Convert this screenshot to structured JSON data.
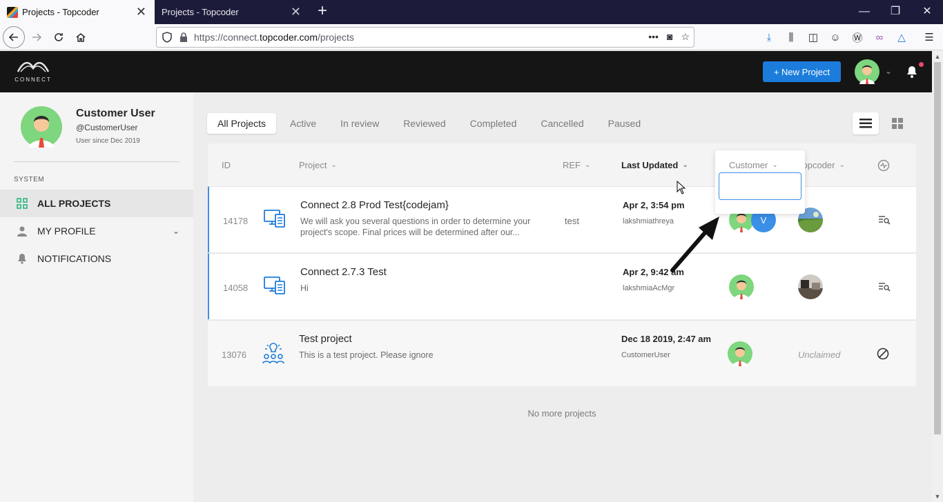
{
  "browser": {
    "tabs": [
      {
        "title": "Projects - Topcoder"
      },
      {
        "title": "Projects - Topcoder"
      }
    ],
    "url_prefix": "https://connect.",
    "url_domain": "topcoder.com",
    "url_path": "/projects"
  },
  "header": {
    "logo_text": "CONNECT",
    "new_project_label": "+ New Project"
  },
  "sidebar": {
    "name": "Customer User",
    "handle": "@CustomerUser",
    "since": "User since Dec 2019",
    "section_label": "SYSTEM",
    "items": [
      {
        "label": "ALL PROJECTS"
      },
      {
        "label": "MY PROFILE"
      },
      {
        "label": "NOTIFICATIONS"
      }
    ]
  },
  "filters": {
    "tabs": [
      "All Projects",
      "Active",
      "In review",
      "Reviewed",
      "Completed",
      "Cancelled",
      "Paused"
    ]
  },
  "table": {
    "headers": {
      "id": "ID",
      "project": "Project",
      "ref": "REF",
      "last_updated": "Last Updated",
      "customer": "Customer",
      "topcoder": "Topcoder"
    },
    "rows": [
      {
        "id": "14178",
        "title": "Connect 2.8 Prod Test{codejam}",
        "desc": "We will ask you several questions in order to determine your project's scope. Final prices will be determined after our...",
        "ref": "test",
        "date": "Apr 2, 3:54 pm",
        "user": "lakshmiathreya",
        "extra_customer": "V",
        "topcoder": ""
      },
      {
        "id": "14058",
        "title": "Connect 2.7.3 Test",
        "desc": "Hi",
        "ref": "",
        "date": "Apr 2, 9:42 am",
        "user": "lakshmiaAcMgr",
        "topcoder": ""
      },
      {
        "id": "13076",
        "title": "Test project",
        "desc": "This is a test project. Please ignore",
        "ref": "",
        "date": "Dec 18 2019, 2:47 am",
        "user": "CustomerUser",
        "topcoder": "Unclaimed"
      }
    ],
    "footer": "No more projects"
  },
  "popup": {
    "label": "Customer",
    "input_value": ""
  },
  "colors": {
    "accent": "#1b7cdb",
    "header_bg": "#151515",
    "tab_bar": "#1c1b3a"
  }
}
